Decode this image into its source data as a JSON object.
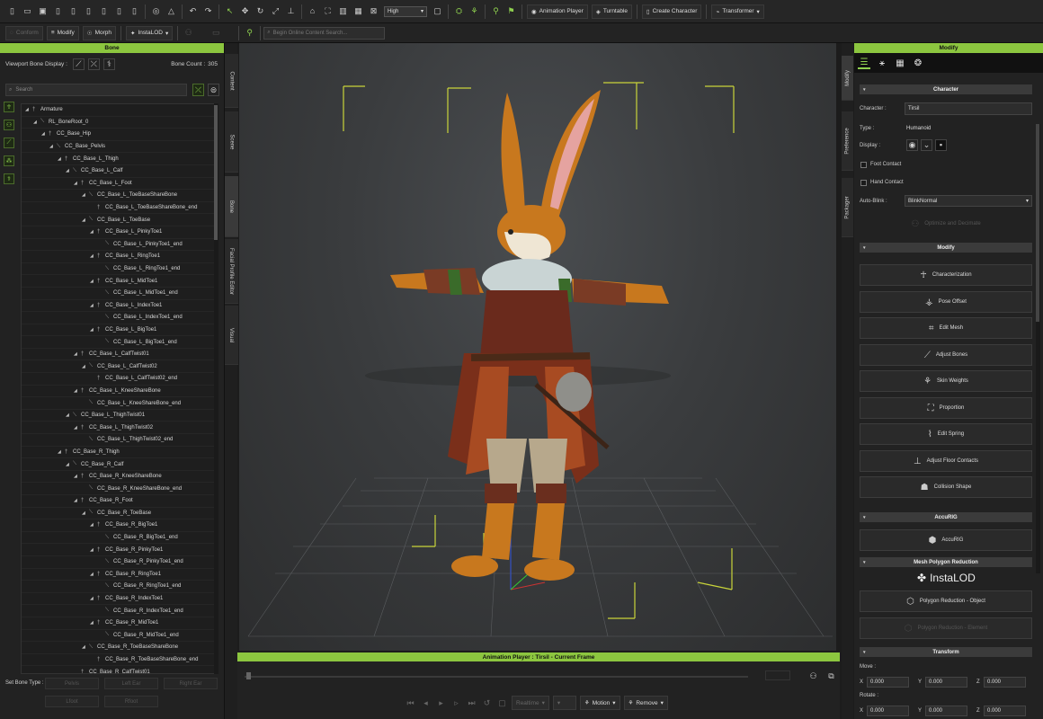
{
  "toolbar1": {
    "quality_select": "High",
    "animation_player_label": "Animation Player",
    "turntable_label": "Turntable",
    "create_character_label": "Create Character",
    "transformer_label": "Transformer"
  },
  "toolbar2": {
    "conform_label": "Conform",
    "modify_label": "Modify",
    "morph_label": "Morph",
    "instalod_label": "InstaLOD",
    "search_placeholder": "Begin Online Content Search..."
  },
  "bone_panel": {
    "title": "Bone",
    "viewport_bone_display_label": "Viewport Bone Display :",
    "bone_count_label": "Bone Count :",
    "bone_count_value": "305",
    "search_placeholder": "Search",
    "tree": [
      {
        "label": "Armature",
        "depth": 0
      },
      {
        "label": "RL_BoneRoot_0",
        "depth": 1
      },
      {
        "label": "CC_Base_Hip",
        "depth": 2
      },
      {
        "label": "CC_Base_Pelvis",
        "depth": 3
      },
      {
        "label": "CC_Base_L_Thigh",
        "depth": 4
      },
      {
        "label": "CC_Base_L_Calf",
        "depth": 5
      },
      {
        "label": "CC_Base_L_Foot",
        "depth": 6
      },
      {
        "label": "CC_Base_L_ToeBaseShareBone",
        "depth": 7
      },
      {
        "label": "CC_Base_L_ToeBaseShareBone_end",
        "depth": 8
      },
      {
        "label": "CC_Base_L_ToeBase",
        "depth": 7
      },
      {
        "label": "CC_Base_L_PinkyToe1",
        "depth": 8
      },
      {
        "label": "CC_Base_L_PinkyToe1_end",
        "depth": 9
      },
      {
        "label": "CC_Base_L_RingToe1",
        "depth": 8
      },
      {
        "label": "CC_Base_L_RingToe1_end",
        "depth": 9
      },
      {
        "label": "CC_Base_L_MidToe1",
        "depth": 8
      },
      {
        "label": "CC_Base_L_MidToe1_end",
        "depth": 9
      },
      {
        "label": "CC_Base_L_IndexToe1",
        "depth": 8
      },
      {
        "label": "CC_Base_L_IndexToe1_end",
        "depth": 9
      },
      {
        "label": "CC_Base_L_BigToe1",
        "depth": 8
      },
      {
        "label": "CC_Base_L_BigToe1_end",
        "depth": 9
      },
      {
        "label": "CC_Base_L_CalfTwist01",
        "depth": 6
      },
      {
        "label": "CC_Base_L_CalfTwist02",
        "depth": 7
      },
      {
        "label": "CC_Base_L_CalfTwist02_end",
        "depth": 8
      },
      {
        "label": "CC_Base_L_KneeShareBone",
        "depth": 6
      },
      {
        "label": "CC_Base_L_KneeShareBone_end",
        "depth": 7
      },
      {
        "label": "CC_Base_L_ThighTwist01",
        "depth": 5
      },
      {
        "label": "CC_Base_L_ThighTwist02",
        "depth": 6
      },
      {
        "label": "CC_Base_L_ThighTwist02_end",
        "depth": 7
      },
      {
        "label": "CC_Base_R_Thigh",
        "depth": 4
      },
      {
        "label": "CC_Base_R_Calf",
        "depth": 5
      },
      {
        "label": "CC_Base_R_KneeShareBone",
        "depth": 6
      },
      {
        "label": "CC_Base_R_KneeShareBone_end",
        "depth": 7
      },
      {
        "label": "CC_Base_R_Foot",
        "depth": 6
      },
      {
        "label": "CC_Base_R_ToeBase",
        "depth": 7
      },
      {
        "label": "CC_Base_R_BigToe1",
        "depth": 8
      },
      {
        "label": "CC_Base_R_BigToe1_end",
        "depth": 9
      },
      {
        "label": "CC_Base_R_PinkyToe1",
        "depth": 8
      },
      {
        "label": "CC_Base_R_PinkyToe1_end",
        "depth": 9
      },
      {
        "label": "CC_Base_R_RingToe1",
        "depth": 8
      },
      {
        "label": "CC_Base_R_RingToe1_end",
        "depth": 9
      },
      {
        "label": "CC_Base_R_IndexToe1",
        "depth": 8
      },
      {
        "label": "CC_Base_R_IndexToe1_end",
        "depth": 9
      },
      {
        "label": "CC_Base_R_MidToe1",
        "depth": 8
      },
      {
        "label": "CC_Base_R_MidToe1_end",
        "depth": 9
      },
      {
        "label": "CC_Base_R_ToeBaseShareBone",
        "depth": 7
      },
      {
        "label": "CC_Base_R_ToeBaseShareBone_end",
        "depth": 8
      },
      {
        "label": "CC_Base_R_CalfTwist01",
        "depth": 6
      }
    ],
    "set_bone_type_label": "Set Bone Type :",
    "bone_type_buttons": [
      "Pelvis",
      "Left Ear",
      "Right Ear",
      "Lfoot",
      "Rfoot"
    ]
  },
  "side_tabs": [
    "Content",
    "Scene",
    "Bone",
    "Facial Profile Editor",
    "Visual"
  ],
  "right_tabs": [
    "Modify",
    "Preference",
    "Packager"
  ],
  "animation_player": {
    "title": "Animation Player : Tirsil - Current Frame",
    "realtime_label": "Realtime",
    "motion_label": "Motion",
    "remove_label": "Remove"
  },
  "modify_panel": {
    "title": "Modify",
    "character_section": "Character",
    "character_label": "Character :",
    "character_value": "Tirsil",
    "type_label": "Type :",
    "type_value": "Humanoid",
    "display_label": "Display :",
    "foot_contact_label": "Foot Contact",
    "hand_contact_label": "Hand Contact",
    "auto_blink_label": "Auto-Blink :",
    "auto_blink_value": "BlinkNormal",
    "optimize_label": "Optimize and Decimate",
    "modify_section": "Modify",
    "modify_buttons": [
      "Characterization",
      "Pose Offset",
      "Edit Mesh",
      "Adjust Bones",
      "Skin Weights",
      "Proportion",
      "Edit Spring",
      "Adjust Floor Contacts",
      "Collision Shape"
    ],
    "accurig_section": "AccuRIG",
    "accurig_button": "AccuRIG",
    "mesh_polygon_section": "Mesh Polygon Reduction",
    "instalod_logo": "InstaLOD",
    "polygon_object_label": "Polygon Reduction - Object",
    "polygon_element_label": "Polygon Reduction - Element",
    "transform_section": "Transform",
    "move_label": "Move :",
    "rotate_label": "Rotate :",
    "axis_labels": [
      "X",
      "Y",
      "Z"
    ],
    "move_values": [
      "0.000",
      "0.000",
      "0.000"
    ],
    "rotate_values": [
      "0.000",
      "0.000",
      "0.000"
    ]
  },
  "colors": {
    "accent_green": "#8cc63f",
    "panel_bg": "#222222",
    "viewport_bg": "#3a3c3e"
  }
}
